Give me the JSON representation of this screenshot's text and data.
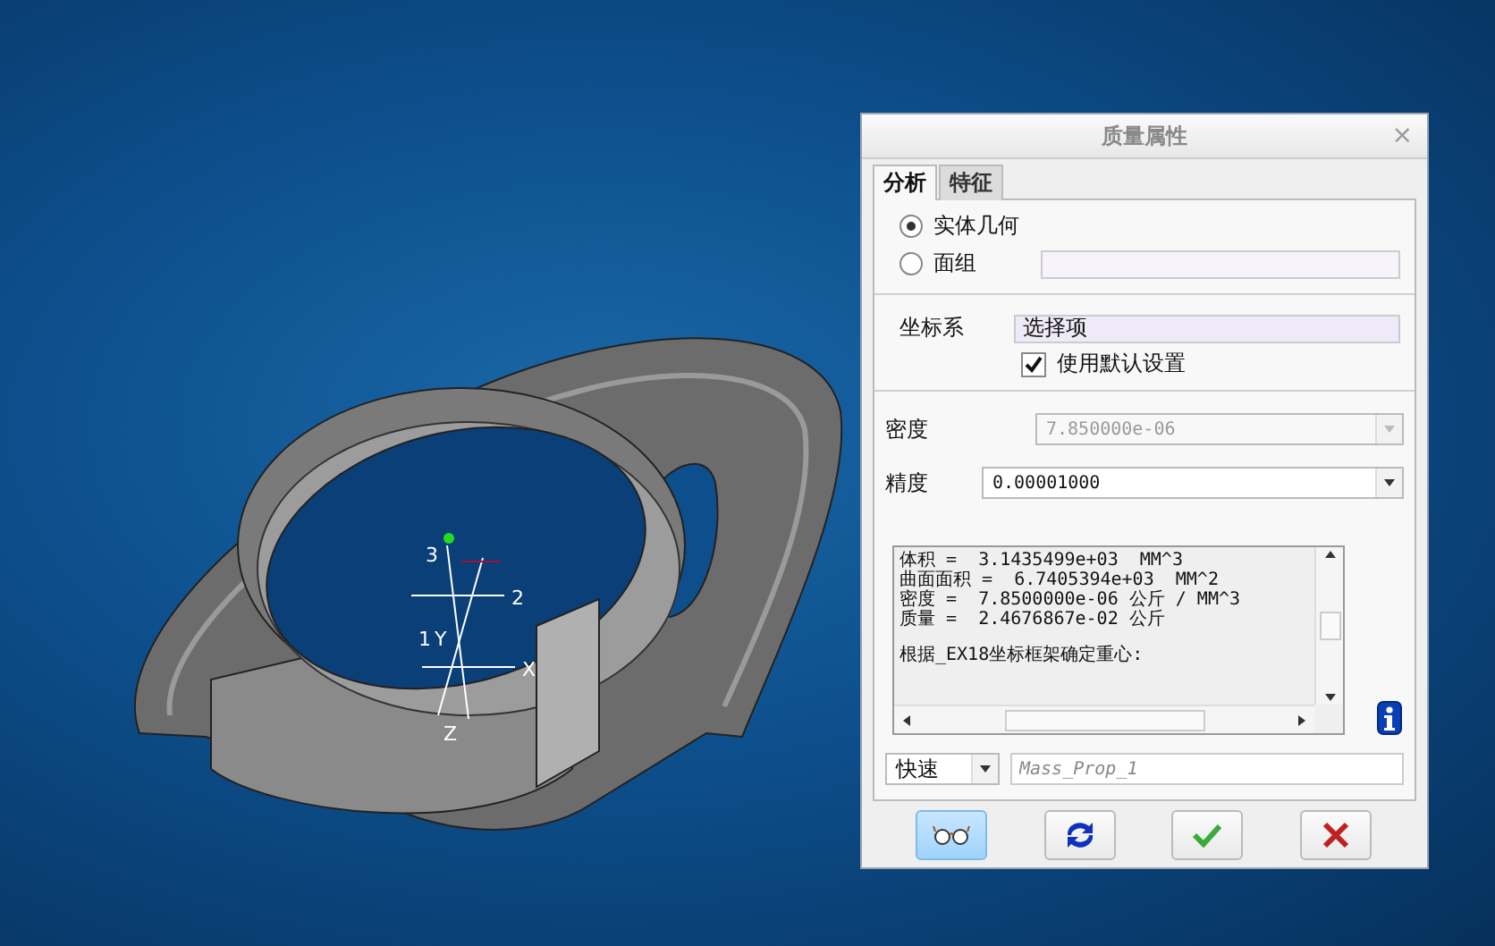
{
  "window": {
    "title": "质量属性",
    "close": "×"
  },
  "tabs": [
    {
      "label": "分析",
      "selected": true
    },
    {
      "label": "特征",
      "selected": false
    }
  ],
  "geometry": [
    {
      "label": "实体几何",
      "selected": true
    },
    {
      "label": "面组",
      "selected": false
    }
  ],
  "coordinate_system": {
    "label": "坐标系",
    "value": "选择项",
    "use_default": {
      "label": "使用默认设置",
      "checked": true
    }
  },
  "density": {
    "label": "密度",
    "value": "7.850000e-06",
    "disabled": true
  },
  "precision": {
    "label": "精度",
    "value": "0.00001000"
  },
  "results": {
    "values": [
      "体积 =  3.1435499e+03  MM^3",
      "曲面面积 =  6.7405394e+03  MM^2",
      "密度 =  7.8500000e-06 公斤 / MM^3",
      "质量 =  2.4676867e-02 公斤"
    ],
    "note": "根据_EX18坐标框架确定重心:"
  },
  "mode": {
    "value": "快速"
  },
  "name_field": {
    "placeholder": "Mass_Prop_1"
  },
  "model_labels": [
    "3",
    "2",
    "1",
    "Y",
    "X",
    "Z"
  ]
}
